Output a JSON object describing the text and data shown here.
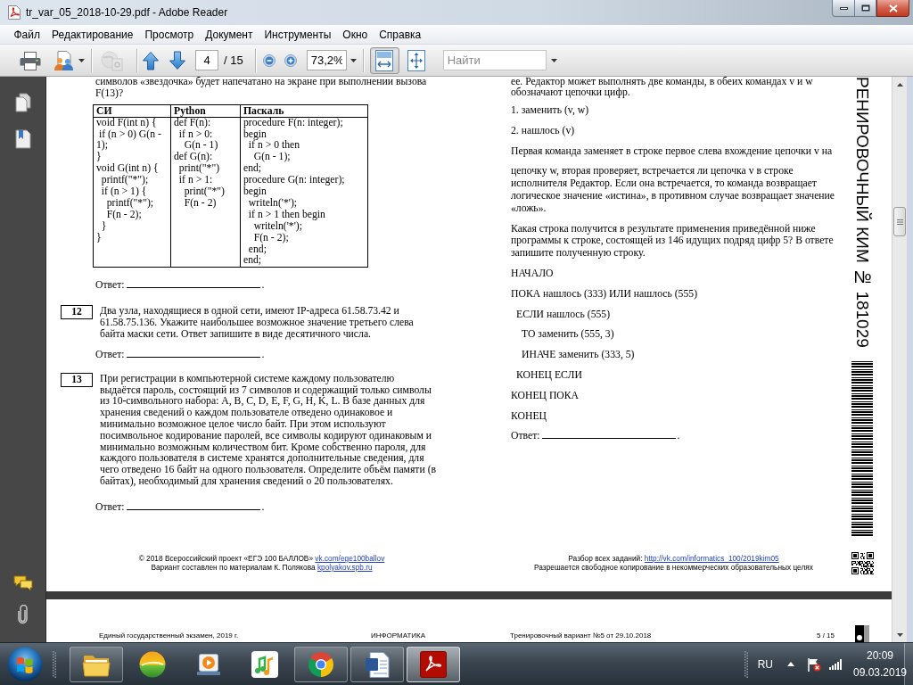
{
  "window": {
    "title": "tr_var_05_2018-10-29.pdf - Adobe Reader"
  },
  "menu": [
    "Файл",
    "Редактирование",
    "Просмотр",
    "Документ",
    "Инструменты",
    "Окно",
    "Справка"
  ],
  "toolbar": {
    "tools": [
      {
        "kind": "print",
        "disabled": false
      },
      {
        "kind": "share",
        "disabled": false
      },
      {
        "kind": "collaborate",
        "disabled": true
      }
    ],
    "page_nav": {
      "page": "4",
      "total": "/ 15"
    },
    "zoom": {
      "value": "73,2%"
    },
    "view_modes": [
      {
        "kind": "fit-width",
        "selected": true
      },
      {
        "kind": "fit-page",
        "selected": false
      }
    ],
    "search": {
      "placeholder": "Найти"
    }
  },
  "document": {
    "left_column": {
      "intro": [
        "символов «звездочка» будет напечатано на экране при выполнении вызова",
        "F(13)?"
      ],
      "code_table": {
        "columns": [
          "СИ",
          "Python",
          "Паскаль"
        ],
        "cells": [
          [
            "void F(int n) {",
            " if (n > 0) G(n -",
            "1);",
            "}",
            "void G(int n) {",
            "  printf(\"*\");",
            "  if (n > 1) {",
            "    printf(\"*\");",
            "    F(n - 2);",
            "  }",
            "}"
          ],
          [
            "def F(n):",
            "  if n > 0:",
            "    G(n - 1)",
            "def G(n):",
            "  print(\"*\")",
            "  if n > 1:",
            "    print(\"*\")",
            "    F(n - 2)"
          ],
          [
            "procedure F(n: integer);",
            "begin",
            "  if n > 0 then",
            "    G(n - 1);",
            "end;",
            "procedure G(n: integer);",
            "begin",
            "  writeln('*');",
            "  if n > 1 then begin",
            "    writeln('*');",
            "    F(n - 2);",
            "  end;",
            "end;"
          ]
        ]
      },
      "answer": {
        "label": "Ответ:",
        "end": "."
      },
      "questions": [
        {
          "number": "12",
          "lines": [
            "Два узла, находящиеся в одной сети, имеют IP-адреса 61.58.73.42 и",
            "61.58.75.136. Укажите наибольшее возможное значение третьего слева",
            "байта маски сети. Ответ запишите в виде десятичного числа."
          ],
          "answer": {
            "label": "Ответ:",
            "end": "."
          }
        },
        {
          "number": "13",
          "lines": [
            "При регистрации в компьютерной системе каждому пользователю",
            "выдаётся пароль, состоящий из 7 символов и содержащий только символы",
            "из 10-символьного набора: A, B, C, D, E, F, G, H, K, L. В базе данных для",
            "хранения сведений о каждом пользователе отведено одинаковое и",
            "минимально возможное целое число байт. При этом используют",
            "посимвольное кодирование паролей, все символы кодируют одинаковым и",
            "минимально возможным количеством бит. Кроме собственно пароля, для",
            "каждого пользователя в системе хранятся дополнительные сведения, для",
            "чего отведено 16 байт на одного пользователя. Определите объём памяти (в",
            "байтах), необходимый для хранения сведений о 20 пользователях."
          ],
          "answer": {
            "label": "Ответ:",
            "end": "."
          }
        }
      ]
    },
    "right_column": {
      "paragraphs": [
        [
          "ее. Редактор может выполнять две команды, в обеих командах v и w",
          "обозначают цепочки цифр."
        ],
        [
          "1. заменить (v, w)"
        ],
        [
          "2. нашлось (v)"
        ],
        [
          "Первая команда заменяет в строке первое слева вхождение цепочки v на"
        ],
        [
          "цепочку w, вторая проверяет, встречается ли цепочка v в строке",
          "исполнителя Редактор. Если она встречается, то команда возвращает",
          "логическое значение «истина», в противном случае возвращает значение",
          "«ложь»."
        ],
        [
          "Какая строка получится в результате применения приведённой ниже",
          "программы к строке, состоящей из 146 идущих подряд цифр 5? В ответе",
          "запишите полученную строку."
        ]
      ],
      "program": [
        {
          "text": "НАЧАЛО"
        },
        {
          "text": "ПОКА нашлось (333) ИЛИ нашлось (555)",
          "children": [
            {
              "text": "ЕСЛИ нашлось (555)",
              "children": [
                {
                  "text": "ТО заменить (555, 3)"
                },
                {
                  "text": "ИНАЧЕ заменить (333, 5)"
                }
              ]
            },
            {
              "text": "КОНЕЦ ЕСЛИ"
            }
          ]
        },
        {
          "text": "КОНЕЦ ПОКА"
        },
        {
          "text": "КОНЕЦ"
        }
      ],
      "answer": {
        "label": "Ответ:",
        "end": "."
      }
    },
    "side_label": "РЕНИРОВОЧНЫЙ КИМ № 181029",
    "footer": {
      "left": [
        {
          "text": "© 2018 Всероссийский проект «ЕГЭ 100 БАЛЛОВ»",
          "link": "vk.com/ege100ballov"
        },
        {
          "text": "Вариант составлен по материалам К. Полякова",
          "link": "kpolyakov.spb.ru"
        }
      ],
      "right": [
        {
          "text": "Разбор всех заданий:",
          "link": "http://vk.com/informatics_100/2019kim05"
        },
        {
          "text": "Разрешается свободное копирование в некоммерческих образовательных целях"
        }
      ]
    },
    "next_page": {
      "header": [
        "Единый государственный экзамен, 2019 г.",
        "ИНФОРМАТИКА",
        "Тренировочный вариант №5 от 29.10.2018",
        "5 / 15"
      ]
    }
  },
  "taskbar": {
    "apps": [
      {
        "kind": "explorer",
        "running": true,
        "selected": false
      },
      {
        "kind": "sphere",
        "running": false,
        "selected": false
      },
      {
        "kind": "media",
        "running": false,
        "selected": false
      },
      {
        "kind": "music",
        "running": false,
        "selected": false
      },
      {
        "kind": "browser",
        "running": true,
        "selected": false
      },
      {
        "kind": "word",
        "running": true,
        "selected": false
      },
      {
        "kind": "reader",
        "running": true,
        "selected": true
      }
    ],
    "tray": {
      "language": "RU",
      "time": "20:09",
      "date": "09.03.2019"
    }
  }
}
